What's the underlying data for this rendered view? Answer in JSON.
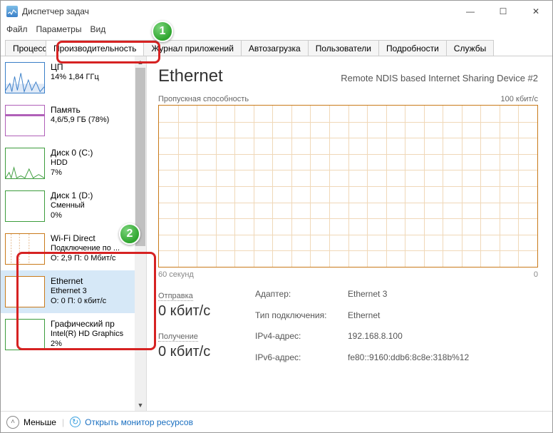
{
  "window": {
    "title": "Диспетчер задач",
    "minTip": "—",
    "maxTip": "☐",
    "closeTip": "✕"
  },
  "menu": {
    "file": "Файл",
    "options": "Параметры",
    "view": "Вид"
  },
  "tabs": {
    "processes": "Процессы",
    "performance": "Производительность",
    "apphistory": "Журнал приложений",
    "startup": "Автозагрузка",
    "users": "Пользователи",
    "details": "Подробности",
    "services": "Службы"
  },
  "sidebar": {
    "cpu": {
      "title": "ЦП",
      "line": "14% 1,84 ГГц"
    },
    "memory": {
      "title": "Память",
      "line": "4,6/5,9 ГБ (78%)"
    },
    "disk0": {
      "title": "Диск 0 (C:)",
      "sub": "HDD",
      "pct": "7%"
    },
    "disk1": {
      "title": "Диск 1 (D:)",
      "sub": "Сменный",
      "pct": "0%"
    },
    "wifi": {
      "title": "Wi-Fi Direct",
      "sub": "Подключение по ...",
      "rate": "О: 2,9 П: 0 Мбит/с"
    },
    "eth": {
      "title": "Ethernet",
      "sub": "Ethernet 3",
      "rate": "О: 0 П: 0 кбит/с"
    },
    "gpu": {
      "title": "Графический пр",
      "sub": "Intel(R) HD Graphics",
      "pct": "2%"
    }
  },
  "main": {
    "title": "Ethernet",
    "adapterName": "Remote NDIS based Internet Sharing Device #2",
    "chartLabel": "Пропускная способность",
    "yMax": "100 кбит/с",
    "xLeft": "60 секунд",
    "xRight": "0",
    "send": {
      "label": "Отправка",
      "value": "0 кбит/с"
    },
    "recv": {
      "label": "Получение",
      "value": "0 кбит/с"
    },
    "info": {
      "adapterLbl": "Адаптер:",
      "adapterVal": "Ethernet 3",
      "typeLbl": "Тип подключения:",
      "typeVal": "Ethernet",
      "ipv4Lbl": "IPv4-адрес:",
      "ipv4Val": "192.168.8.100",
      "ipv6Lbl": "IPv6-адрес:",
      "ipv6Val": "fe80::9160:ddb6:8c8e:318b%12"
    }
  },
  "footer": {
    "less": "Меньше",
    "resmon": "Открыть монитор ресурсов"
  },
  "callouts": {
    "b1": "1",
    "b2": "2"
  }
}
